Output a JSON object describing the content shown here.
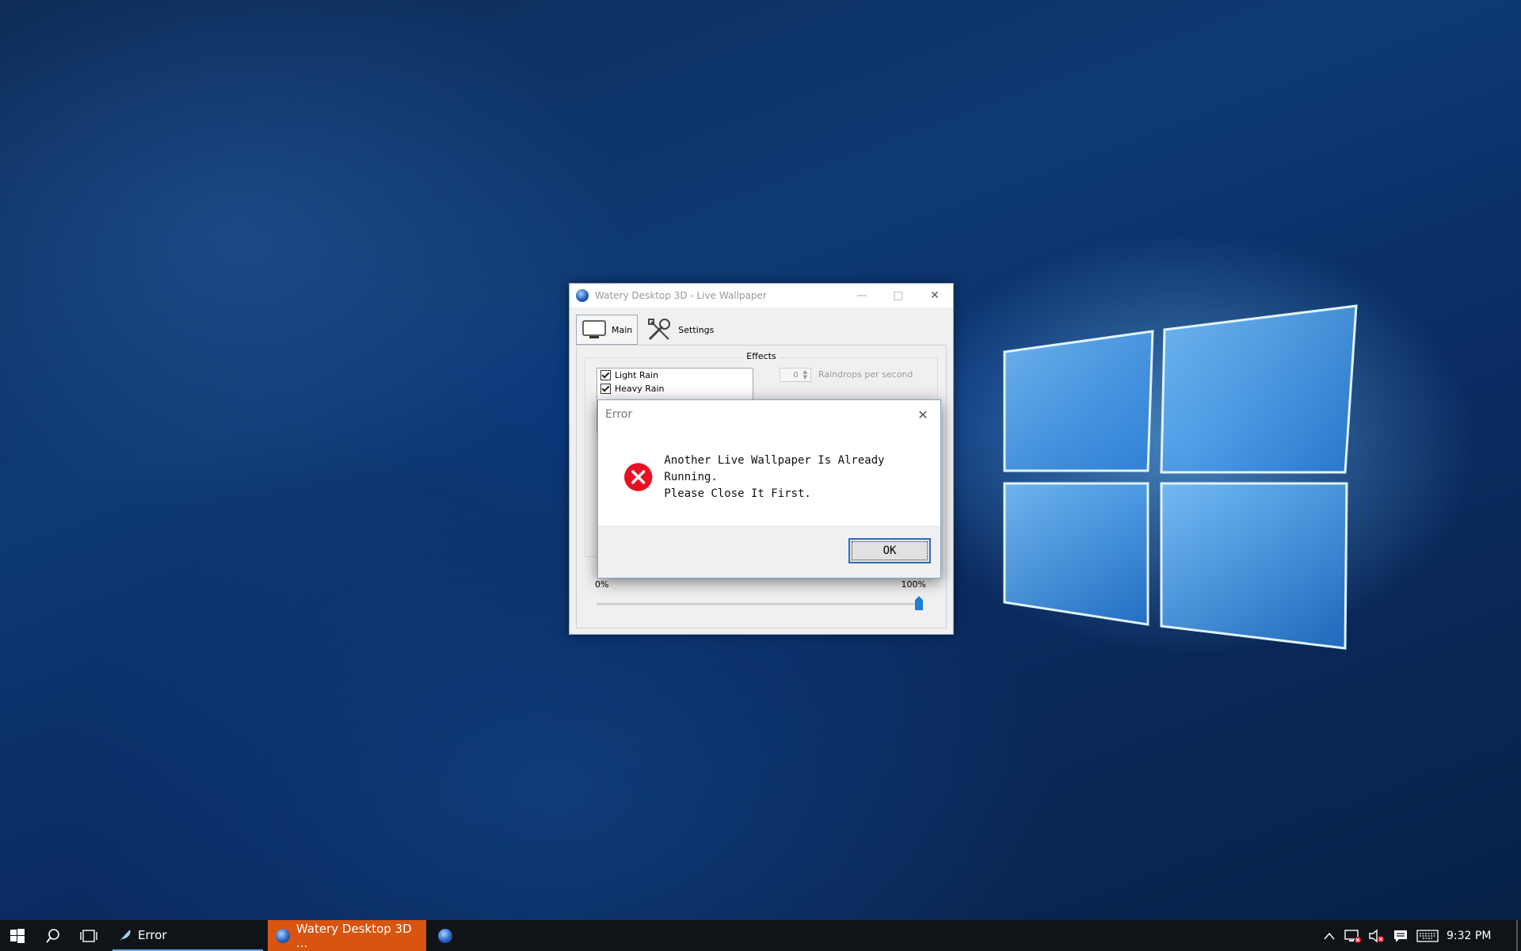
{
  "app_window": {
    "title": "Watery Desktop 3D - Live Wallpaper",
    "tabs": [
      {
        "label": "Main",
        "icon": "monitor-icon",
        "active": true
      },
      {
        "label": "Settings",
        "icon": "tools-icon",
        "active": false
      }
    ],
    "effects": {
      "title": "Effects",
      "items": [
        {
          "label": "Light Rain",
          "checked": true
        },
        {
          "label": "Heavy Rain",
          "checked": true
        }
      ],
      "raindrops_value": "0",
      "raindrops_label": "Raindrops per second"
    },
    "slider": {
      "min_label": "0%",
      "max_label": "100%",
      "value_percent": 100
    }
  },
  "error_dialog": {
    "title": "Error",
    "message_line1": "Another Live Wallpaper Is Already Running.",
    "message_line2": "Please Close It First.",
    "ok_label": "OK",
    "icon": "error-icon",
    "icon_color": "#e81123"
  },
  "taskbar": {
    "items": [
      {
        "label": "Error",
        "icon": "feather-icon"
      },
      {
        "label": "Watery Desktop 3D ...",
        "icon": "globe-icon",
        "active": true
      }
    ],
    "clock": "9:32 PM",
    "active_color": "#d8540f"
  }
}
